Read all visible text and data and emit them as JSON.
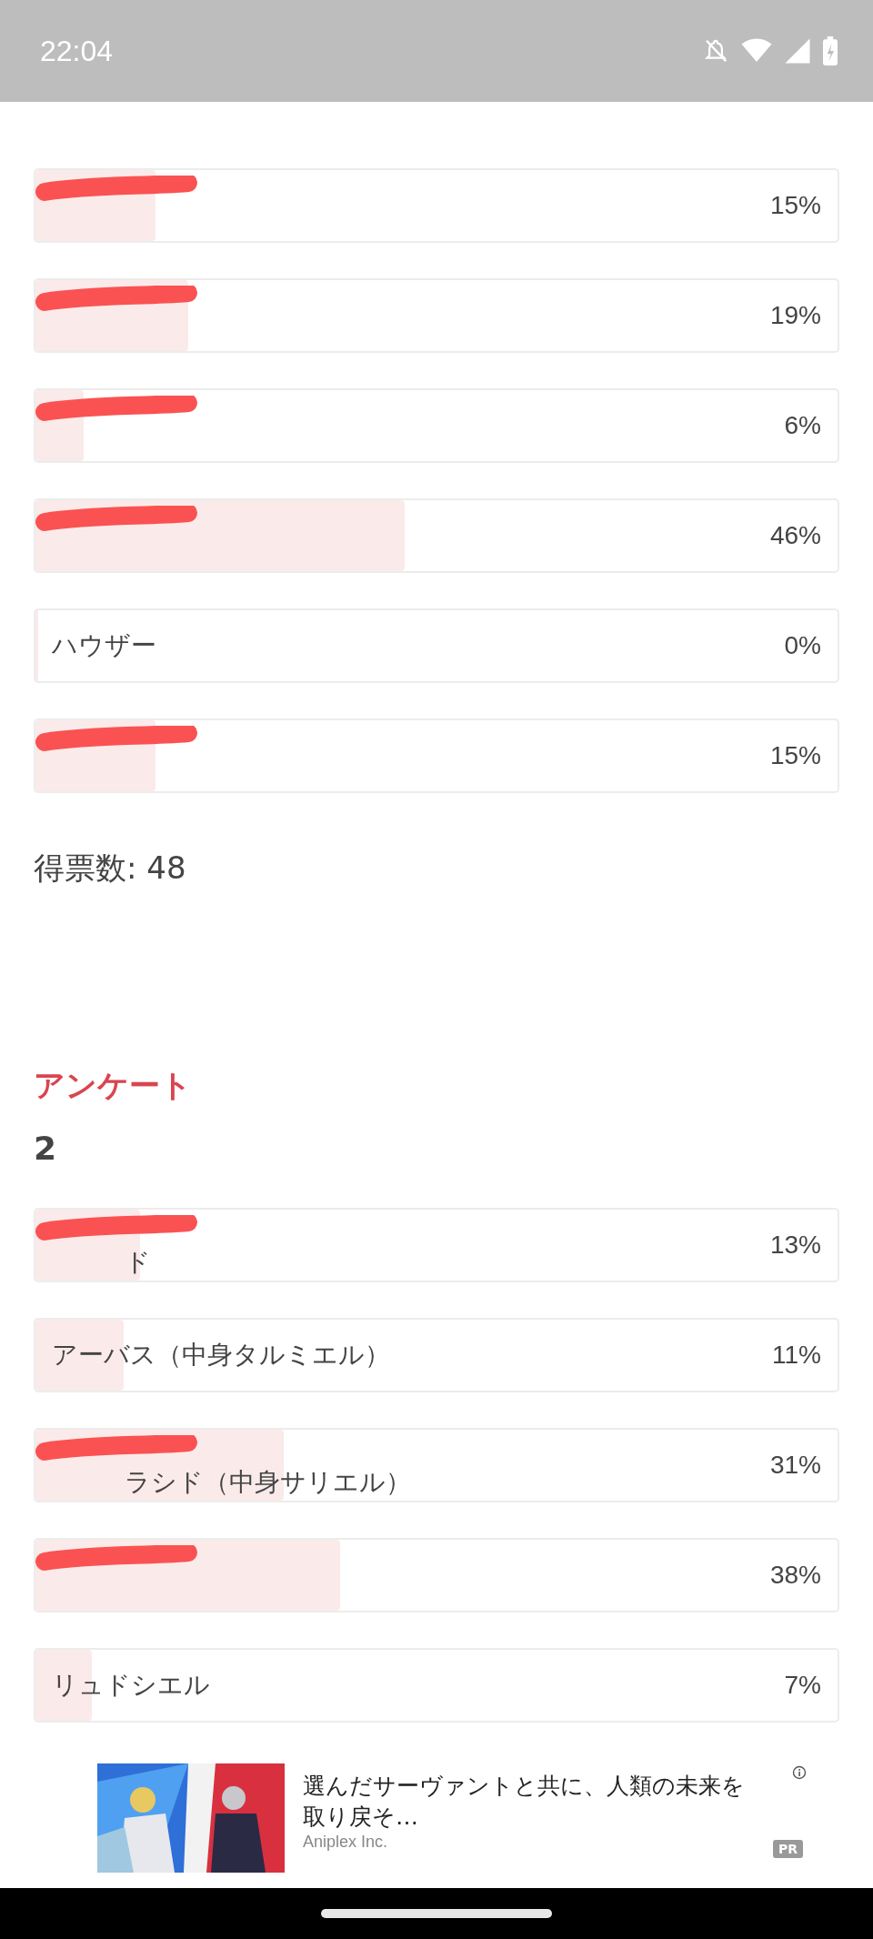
{
  "status_bar": {
    "time": "22:04"
  },
  "polls": [
    {
      "options": [
        {
          "redacted": true,
          "level": 0.15,
          "percent": "15%"
        },
        {
          "redacted": true,
          "level": 0.19,
          "percent": "19%"
        },
        {
          "redacted": true,
          "level": 0.06,
          "percent": "6%"
        },
        {
          "redacted": true,
          "level": 0.46,
          "percent": "46%"
        },
        {
          "redacted": false,
          "label": "ハウザー",
          "level": 0,
          "percent": "0%"
        },
        {
          "redacted": true,
          "level": 0.15,
          "percent": "15%"
        }
      ],
      "vote_count": "得票数: 48"
    },
    {
      "kicker": "アンケート",
      "title": "2",
      "options": [
        {
          "redacted": true,
          "label": "ド",
          "level": 0.13,
          "percent": "13%"
        },
        {
          "redacted": false,
          "label": "アーバス（中身タルミエル）",
          "level": 0.11,
          "percent": "11%"
        },
        {
          "redacted": true,
          "label": "ラシド（中身サリエル）",
          "level": 0.31,
          "percent": "31%"
        },
        {
          "redacted": true,
          "level": 0.38,
          "percent": "38%"
        },
        {
          "redacted": false,
          "label": "リュドシエル",
          "level": 0.07,
          "percent": "7%"
        }
      ]
    }
  ],
  "ad": {
    "kind": "picture",
    "text": "選んだサーヴァントと共に、人類の未来を取り戻そ…",
    "advertiser": "Aniplex Inc.",
    "badge": "PR"
  }
}
